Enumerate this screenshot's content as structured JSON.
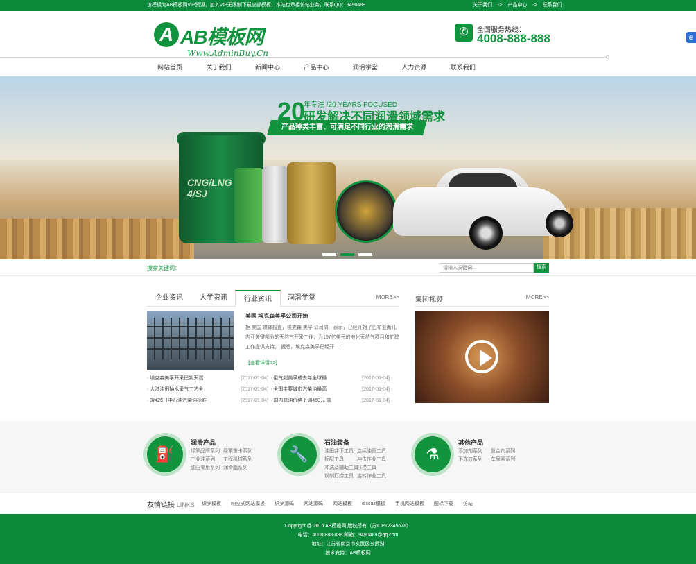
{
  "topbar": {
    "notice": "该模板为AB模板网VIP资源，加入VIP无限制下载全部模板，本站也承接仿站业务，联系QQ：9490489",
    "links": [
      "关于我们",
      "->",
      "产品中心",
      "->",
      "联系我们"
    ]
  },
  "header": {
    "logo_letter": "A",
    "logo_text": "AB模板网",
    "logo_sub": "Www.AdminBuy.Cn",
    "hotline_label": "全国服务热线：",
    "hotline_number": "4008-888-888"
  },
  "nav": {
    "items": [
      "网站首页",
      "关于我们",
      "新闻中心",
      "产品中心",
      "润滑学堂",
      "人力资源",
      "联系我们"
    ]
  },
  "banner": {
    "number": "20",
    "small": "年专注 /20 YEARS FOCUSED",
    "headline": "研发解决不同润滑领域需求",
    "ribbon": "产品种类丰富、可满足不同行业的润滑需求",
    "bucket_label": "CNG/LNG CH-4/SJ",
    "active_slide": 2,
    "slide_count": 3
  },
  "search": {
    "label": "搜索关键词：",
    "placeholder": "请输入关键词...",
    "button": "搜索"
  },
  "news": {
    "tabs": [
      "企业资讯",
      "大学资讯",
      "行业资讯",
      "润滑学堂"
    ],
    "active_tab": "行业资讯",
    "more": "MORE>>",
    "headline": "美国 埃克森美孚公司开始",
    "summary": "据 美国 媒体报道，埃克森 美孚 公司周一表示，已经开始了巴布亚新几内亚关键部分的天然气开采工作，为157亿美元的液化天然气项目和扩建工作提供支持。 据悉，埃克森美孚已经开......",
    "detail": "【查看详情>>】",
    "left_list": [
      {
        "title": "埃克森美孚开采巴新天然",
        "date": "[2017-01-04]"
      },
      {
        "title": "大港油田抽水采气工艺全",
        "date": "[2017-01-04]"
      },
      {
        "title": "3月25日中石油汽柴油标准",
        "date": "[2017-01-04]"
      }
    ],
    "right_list": [
      {
        "title": "俄气超美孚成去年全球最",
        "date": "[2017-01-04]"
      },
      {
        "title": "全国主要城市汽柴油最高",
        "date": "[2017-01-04]"
      },
      {
        "title": "国内航油价格下调460元 需",
        "date": "[2017-01-04]"
      }
    ]
  },
  "video": {
    "title": "集团视频",
    "more": "MORE>>"
  },
  "products": [
    {
      "title": "润滑产品",
      "icon": "oil-can-icon",
      "items": [
        "绿擎品牌系列",
        "绿擎重卡系列",
        "工业油系列",
        "工程机械系列",
        "油田专用系列",
        "润滑脂系列"
      ]
    },
    {
      "title": "石油装备",
      "icon": "wrench-icon",
      "items": [
        "油田井下工具",
        "连续油管工具",
        "标配工具",
        "冲击作业工具",
        "冲洗及辅助工具",
        "打捞工具",
        "钢制打捞工具",
        "旋转作业工具"
      ]
    },
    {
      "title": "其他产品",
      "icon": "flask-icon",
      "items": [
        "添加剂系列",
        "复合剂系列",
        "不冻液系列",
        "车尿素系列"
      ]
    }
  ],
  "friends": {
    "label": "友情链接",
    "label_en": "LINKS",
    "links": [
      "织梦模板",
      "响应式网站模板",
      "织梦源码",
      "网站源码",
      "网站模板",
      "discuz模板",
      "手机网站模板",
      "图标下载",
      "仿站"
    ]
  },
  "footer": {
    "copyright": "Copyright @ 2016 AB模板网 版权所有（苏ICP12345678）",
    "contact": "电话：4008-888-888    邮箱：9490489@qq.com",
    "address": "地址：江苏省南京市玄武区玄武湖",
    "support": "技术支持：AB模板网"
  },
  "colors": {
    "brand": "#12943f",
    "topbar": "#0c8a3c"
  }
}
